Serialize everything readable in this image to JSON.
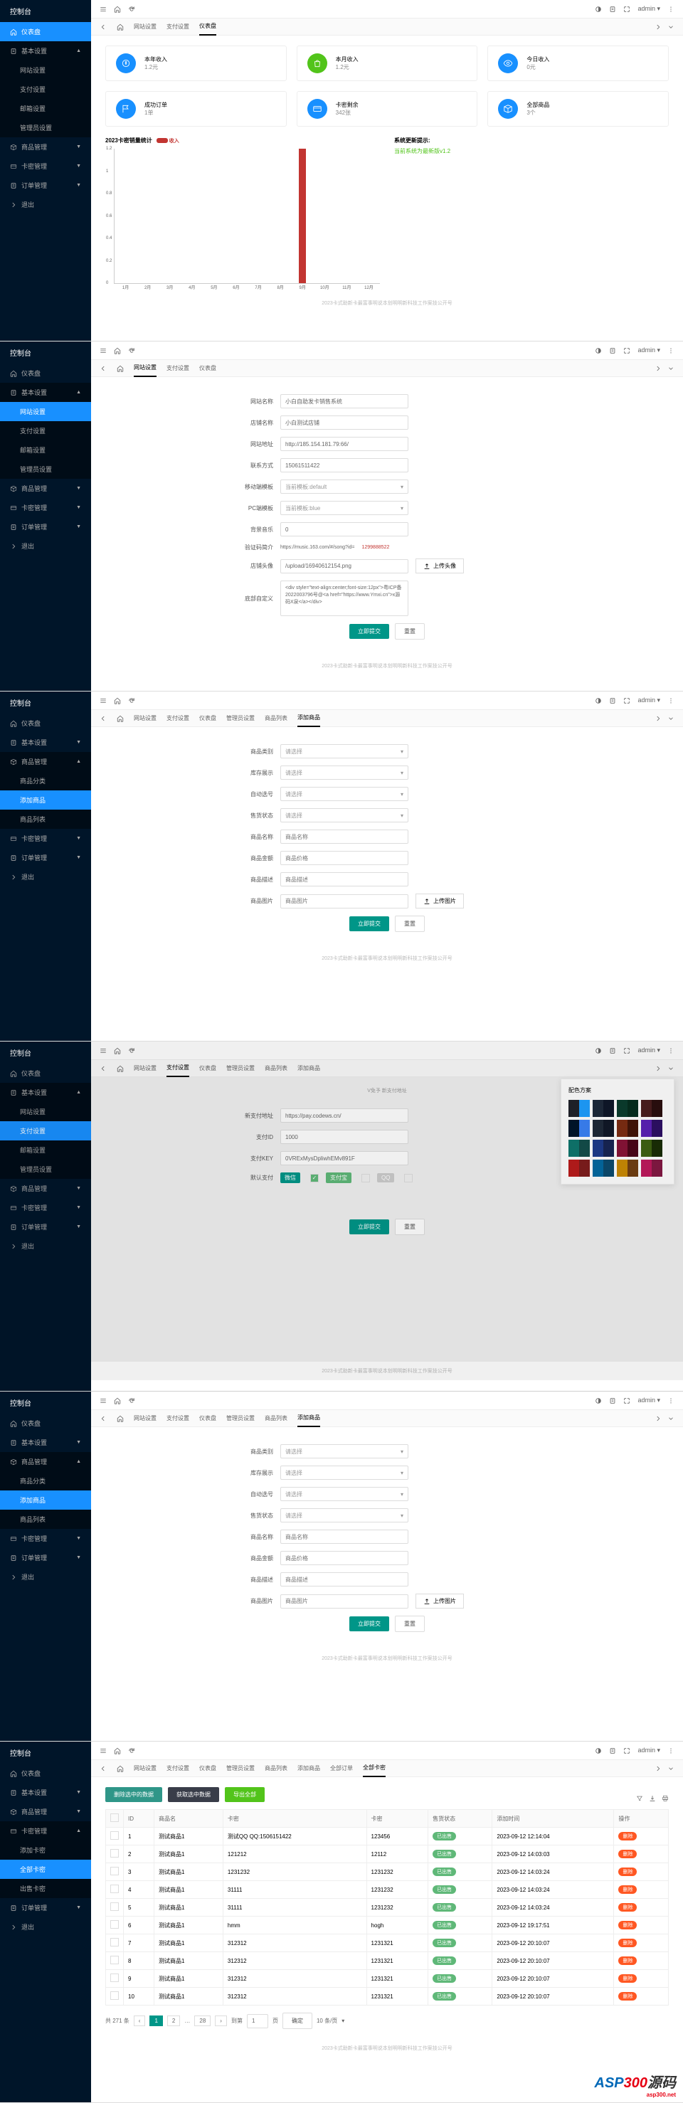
{
  "common": {
    "title": "控制台",
    "admin": "admin",
    "footer": "2023卡式助新卡最富事明说本划明明新科技工作案技公开号"
  },
  "nav": {
    "dashboard": "仪表盘",
    "basic": "基本设置",
    "site": "网站设置",
    "pay": "支付设置",
    "mail": "邮箱设置",
    "admin": "管理员设置",
    "goods": "商品管理",
    "goodsCat": "商品分类",
    "goodsList": "商品列表",
    "addGoods": "添加商品",
    "card": "卡密管理",
    "addCard": "添加卡密",
    "selling": "出售卡密",
    "allCard": "全部卡密",
    "order": "订单管理",
    "logout": "退出"
  },
  "tabs": {
    "site": "网站设置",
    "pay": "支付设置",
    "dashboard": "仪表盘",
    "adminSet": "管理员设置",
    "goodsList": "商品列表",
    "addGoods": "添加商品",
    "allOrder": "全部订单",
    "allCard": "全部卡密"
  },
  "p1": {
    "cards": [
      {
        "title": "本年收入",
        "val": "1.2元",
        "color": "#1890ff"
      },
      {
        "title": "本月收入",
        "val": "1.2元",
        "color": "#52c41a"
      },
      {
        "title": "今日收入",
        "val": "0元",
        "color": "#1890ff"
      },
      {
        "title": "成功订单",
        "val": "1单",
        "color": "#1890ff"
      },
      {
        "title": "卡密剩余",
        "val": "342张",
        "color": "#1890ff"
      },
      {
        "title": "全部商品",
        "val": "3个",
        "color": "#1890ff"
      }
    ],
    "chartTitle": "2023卡密销量统计",
    "legend": "收入",
    "updateTitle": "系统更新提示:",
    "updateText": "当前系统为最新版v1.2",
    "chart_data": {
      "type": "bar",
      "categories": [
        "1月",
        "2月",
        "3月",
        "4月",
        "5月",
        "6月",
        "7月",
        "8月",
        "9月",
        "10月",
        "11月",
        "12月"
      ],
      "values": [
        0,
        0,
        0,
        0,
        0,
        0,
        0,
        0,
        1.2,
        0,
        0,
        0
      ],
      "ylim": [
        0,
        1.2
      ],
      "title": "2023卡密销量统计",
      "xlabel": "",
      "ylabel": ""
    }
  },
  "p2": {
    "labels": {
      "siteName": "网站名称",
      "shopName": "店铺名称",
      "siteUrl": "网站地址",
      "contact": "联系方式",
      "mTpl": "移动端模板",
      "pcTpl": "PC端模板",
      "bgm": "背景音乐",
      "codeIntro": "验证码简介",
      "avatar": "店铺头像",
      "customBottom": "底部自定义",
      "submit": "立即提交",
      "reset": "重置",
      "upload": "上传头像"
    },
    "vals": {
      "siteName": "小白自助发卡销售系统",
      "shopName": "小白测试店铺",
      "siteUrl": "http://185.154.181.79:66/",
      "contact": "15061511422",
      "mTpl": "当前模板:default",
      "pcTpl": "当前模板:blue",
      "bgm": "0",
      "codeIntro": "https://music.163.com/#/song?id=",
      "codeIntroRed": "1299888522",
      "avatar": "/upload/16940612154.png",
      "custom": "<div style=\"text-align:center;font-size:12px\">粤ICP备2022003796号@<a href=\"https://www.Ymxi.cn\">x源码X泉</a></div>"
    }
  },
  "p3": {
    "labels": {
      "cat": "商品类别",
      "stock": "库存展示",
      "auto": "自动选号",
      "status": "售货状态",
      "name": "商品名称",
      "price": "商品金额",
      "desc": "商品描述",
      "img": "商品图片",
      "submit": "立即提交",
      "reset": "重置",
      "upload": "上传图片"
    },
    "ph": {
      "select": "请选择",
      "name": "商品名称",
      "price": "商品价格",
      "desc": "商品描述",
      "img": "商品图片"
    }
  },
  "p4": {
    "labels": {
      "url": "新支付地址",
      "id": "支付ID",
      "key": "支付KEY",
      "default": "默认支付",
      "wx": "微信",
      "alipay": "支付宝",
      "submit": "立即提交",
      "reset": "重置",
      "note": "V免予 新支付地址",
      "theme": "配色方案"
    },
    "vals": {
      "url": "https://pay.codews.cn/",
      "id": "1000",
      "key": "0VRExMysDpliwhEMv891F"
    }
  },
  "p6": {
    "btns": {
      "delSel": "删除选中的数据",
      "exportSel": "获取选中数据",
      "exportAll": "导出全部"
    },
    "headers": {
      "id": "ID",
      "name": "商品名",
      "card": "卡密",
      "pwd": "卡密",
      "status": "售货状态",
      "time": "添加时间",
      "action": "操作"
    },
    "status": {
      "sold": "已出售",
      "unsold": "已出售"
    },
    "action": "删除",
    "rows": [
      {
        "id": "1",
        "name": "测试商品1",
        "card": "测试QQ QQ:1506151422",
        "pwd": "123456",
        "status": "已出售",
        "time": "2023-09-12 12:14:04"
      },
      {
        "id": "2",
        "name": "测试商品1",
        "card": "121212",
        "pwd": "12112",
        "status": "已出售",
        "time": "2023-09-12 14:03:03"
      },
      {
        "id": "3",
        "name": "测试商品1",
        "card": "1231232",
        "pwd": "1231232",
        "status": "已出售",
        "time": "2023-09-12 14:03:24"
      },
      {
        "id": "4",
        "name": "测试商品1",
        "card": "31111",
        "pwd": "1231232",
        "status": "已出售",
        "time": "2023-09-12 14:03:24"
      },
      {
        "id": "5",
        "name": "测试商品1",
        "card": "31111",
        "pwd": "1231232",
        "status": "已出售",
        "time": "2023-09-12 14:03:24"
      },
      {
        "id": "6",
        "name": "测试商品1",
        "card": "hmm",
        "pwd": "hogh",
        "status": "已出售",
        "time": "2023-09-12 19:17:51"
      },
      {
        "id": "7",
        "name": "测试商品1",
        "card": "312312",
        "pwd": "1231321",
        "status": "已出售",
        "time": "2023-09-12 20:10:07"
      },
      {
        "id": "8",
        "name": "测试商品1",
        "card": "312312",
        "pwd": "1231321",
        "status": "已出售",
        "time": "2023-09-12 20:10:07"
      },
      {
        "id": "9",
        "name": "测试商品1",
        "card": "312312",
        "pwd": "1231321",
        "status": "已出售",
        "time": "2023-09-12 20:10:07"
      },
      {
        "id": "10",
        "name": "测试商品1",
        "card": "312312",
        "pwd": "1231321",
        "status": "已出售",
        "time": "2023-09-12 20:10:07"
      }
    ],
    "pagination": {
      "range": "共 271 条",
      "perPage": "10 条/页",
      "go": "到第",
      "page": "页",
      "confirm": "确定"
    }
  }
}
